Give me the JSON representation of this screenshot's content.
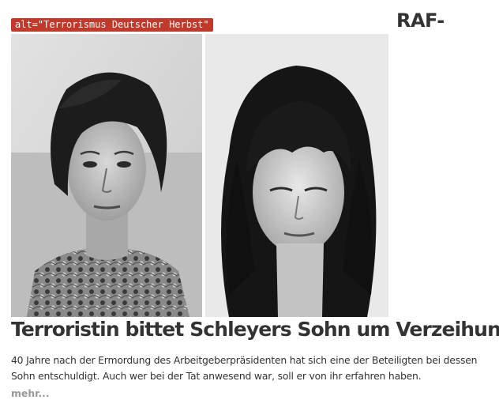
{
  "image": {
    "alt_badge": "alt=\"Terrorismus Deutscher Herbst\""
  },
  "article": {
    "kicker": "RAF-",
    "headline": "Terroristin bittet Schleyers Sohn um Verzeihung",
    "teaser": "40 Jahre nach der Ermordung des Arbeitgeberpräsidenten hat sich eine der Beteiligten bei dessen Sohn entschuldigt. Auch wer bei der Tat anwesend war, soll er von ihr erfahren haben.",
    "more_label": "mehr..."
  },
  "colors": {
    "badge_bg": "#c0392b",
    "text": "#333333",
    "more_link": "#999999"
  }
}
